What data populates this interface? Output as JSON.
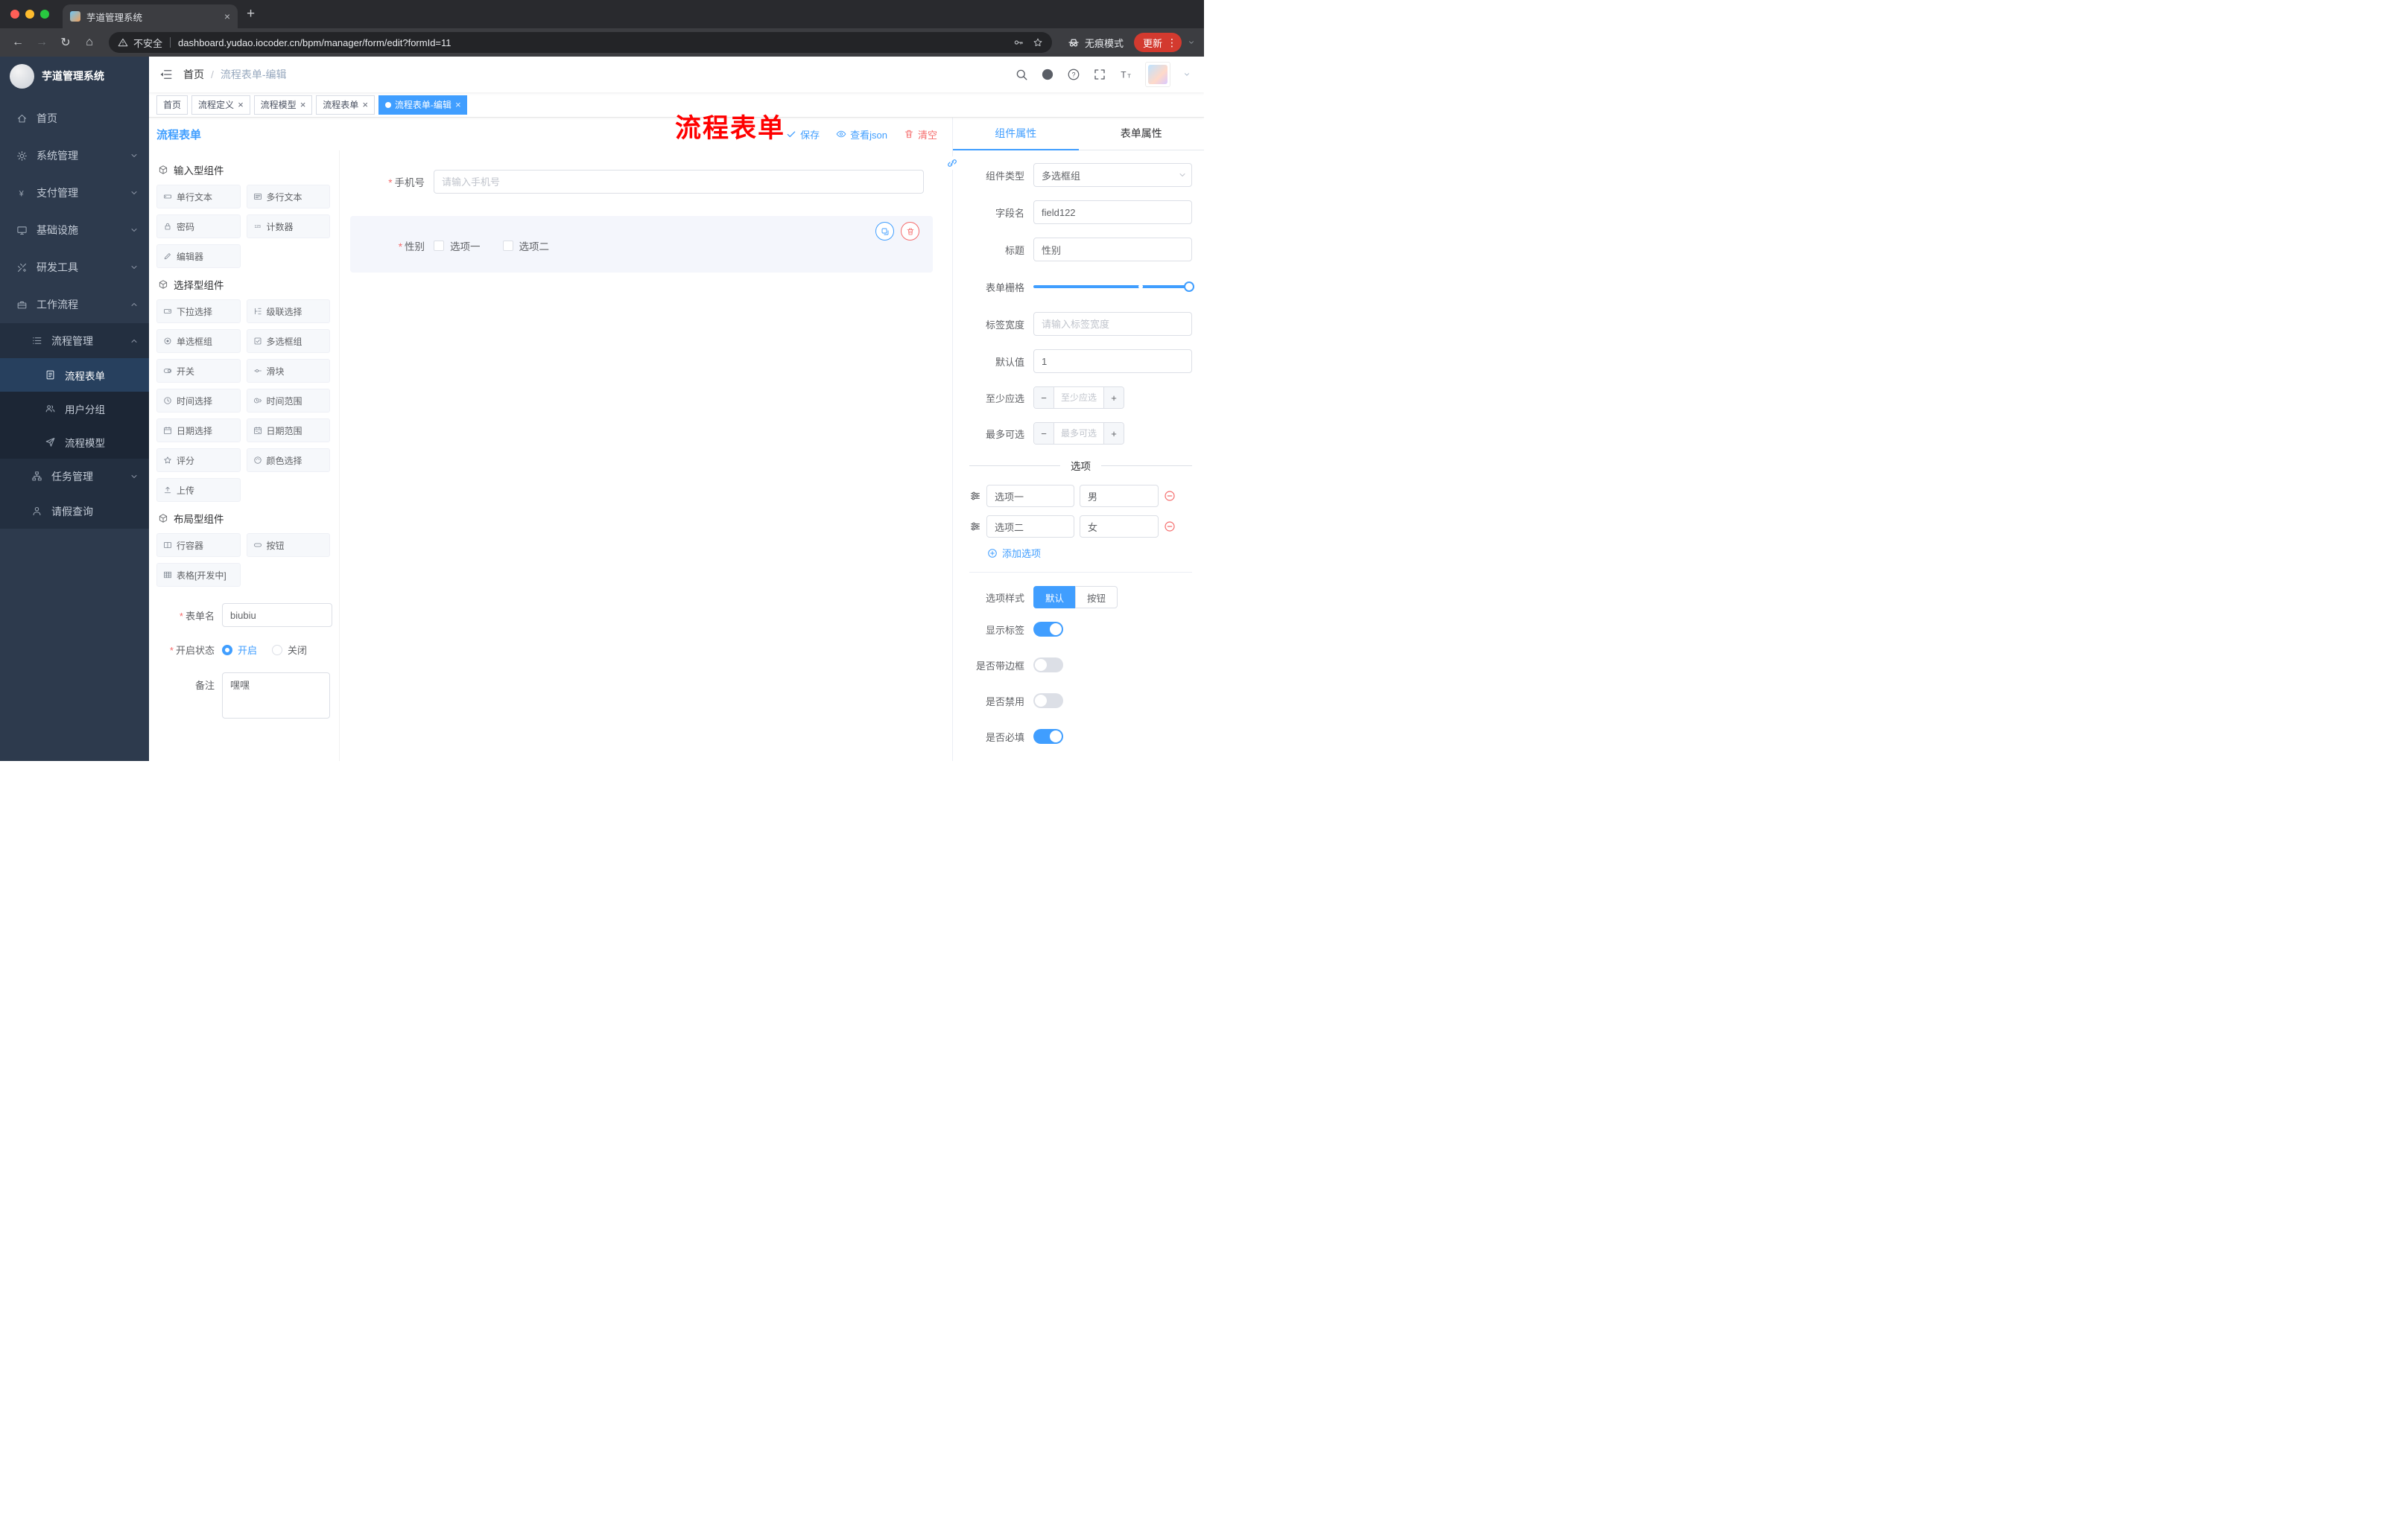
{
  "browser": {
    "tab_title": "芋道管理系统",
    "security": "不安全",
    "url": "dashboard.yudao.iocoder.cn/bpm/manager/form/edit?formId=11",
    "incognito": "无痕模式",
    "update": "更新"
  },
  "sidebar": {
    "title": "芋道管理系统",
    "items": [
      {
        "icon": "home",
        "label": "首页",
        "chevron": "",
        "active": false
      },
      {
        "icon": "gear",
        "label": "系统管理",
        "chevron": "down"
      },
      {
        "icon": "yen",
        "label": "支付管理",
        "chevron": "down"
      },
      {
        "icon": "monitor",
        "label": "基础设施",
        "chevron": "down"
      },
      {
        "icon": "tools",
        "label": "研发工具",
        "chevron": "down"
      },
      {
        "icon": "briefcase",
        "label": "工作流程",
        "chevron": "up"
      },
      {
        "icon": "list",
        "label": "流程管理",
        "lv2": true,
        "chevron": "up"
      },
      {
        "icon": "doc",
        "label": "流程表单",
        "lv3": true,
        "active": true,
        "chevron": ""
      },
      {
        "icon": "users",
        "label": "用户分组",
        "lv3": true,
        "chevron": ""
      },
      {
        "icon": "send",
        "label": "流程模型",
        "lv3": true,
        "chevron": ""
      },
      {
        "icon": "tree",
        "label": "任务管理",
        "lv2": true,
        "chevron": "down"
      },
      {
        "icon": "user",
        "label": "请假查询",
        "lv2": true,
        "chevron": ""
      }
    ]
  },
  "header": {
    "breadcrumb_home": "首页",
    "breadcrumb_sep": "/",
    "breadcrumb_current": "流程表单-编辑",
    "annotation": "流程表单"
  },
  "tags": [
    {
      "label": "首页",
      "closable": false,
      "active": false
    },
    {
      "label": "流程定义",
      "closable": true,
      "active": false
    },
    {
      "label": "流程模型",
      "closable": true,
      "active": false
    },
    {
      "label": "流程表单",
      "closable": true,
      "active": false
    },
    {
      "label": "流程表单-编辑",
      "closable": true,
      "active": true
    }
  ],
  "editor": {
    "title": "流程表单",
    "toolbar": {
      "save": "保存",
      "view_json": "查看json",
      "clear": "清空"
    },
    "palette": {
      "groups": [
        {
          "title": "输入型组件",
          "items": [
            {
              "icon": "field",
              "label": "单行文本"
            },
            {
              "icon": "textarea",
              "label": "多行文本"
            },
            {
              "icon": "lock",
              "label": "密码"
            },
            {
              "icon": "counter",
              "label": "计数器"
            },
            {
              "icon": "pen",
              "label": "编辑器"
            }
          ]
        },
        {
          "title": "选择型组件",
          "items": [
            {
              "icon": "select",
              "label": "下拉选择"
            },
            {
              "icon": "cascade",
              "label": "级联选择"
            },
            {
              "icon": "radio",
              "label": "单选框组"
            },
            {
              "icon": "checkbox",
              "label": "多选框组"
            },
            {
              "icon": "switch",
              "label": "开关"
            },
            {
              "icon": "slider",
              "label": "滑块"
            },
            {
              "icon": "time",
              "label": "时间选择"
            },
            {
              "icon": "timerange",
              "label": "时间范围"
            },
            {
              "icon": "date",
              "label": "日期选择"
            },
            {
              "icon": "daterange",
              "label": "日期范围"
            },
            {
              "icon": "star",
              "label": "评分"
            },
            {
              "icon": "color",
              "label": "颜色选择"
            },
            {
              "icon": "upload",
              "label": "上传"
            }
          ]
        },
        {
          "title": "布局型组件",
          "items": [
            {
              "icon": "row",
              "label": "行容器"
            },
            {
              "icon": "button",
              "label": "按钮"
            },
            {
              "icon": "table",
              "label": "表格[开发中]"
            }
          ]
        }
      ]
    },
    "meta": {
      "name_label": "表单名",
      "name_value": "biubiu",
      "status_label": "开启状态",
      "status_on": "开启",
      "status_off": "关闭",
      "remark_label": "备注",
      "remark_value": "嘿嘿"
    },
    "canvas": {
      "phone_label": "手机号",
      "phone_placeholder": "请输入手机号",
      "gender_label": "性别",
      "gender_opt1": "选项一",
      "gender_opt2": "选项二"
    },
    "props": {
      "tab_component": "组件属性",
      "tab_form": "表单属性",
      "component_type_label": "组件类型",
      "component_type_value": "多选框组",
      "field_label": "字段名",
      "field_value": "field122",
      "title_label": "标题",
      "title_value": "性别",
      "grid_label": "表单栅格",
      "label_width_label": "标签宽度",
      "label_width_placeholder": "请输入标签宽度",
      "default_label": "默认值",
      "default_value": "1",
      "min_label": "至少应选",
      "min_placeholder": "至少应选",
      "max_label": "最多可选",
      "max_placeholder": "最多可选",
      "options_title": "选项",
      "options": [
        {
          "label": "选项一",
          "value": "男"
        },
        {
          "label": "选项二",
          "value": "女"
        }
      ],
      "add_option": "添加选项",
      "style_label": "选项样式",
      "style_default": "默认",
      "style_button": "按钮",
      "toggles": [
        {
          "label": "显示标签",
          "on": true
        },
        {
          "label": "是否带边框",
          "on": false
        },
        {
          "label": "是否禁用",
          "on": false
        },
        {
          "label": "是否必填",
          "on": true
        }
      ]
    }
  },
  "colors": {
    "accent": "#409EFF",
    "danger": "#F56C6C",
    "annotation_red": "#FF0000",
    "sidebar_bg": "#2D3A4D"
  }
}
